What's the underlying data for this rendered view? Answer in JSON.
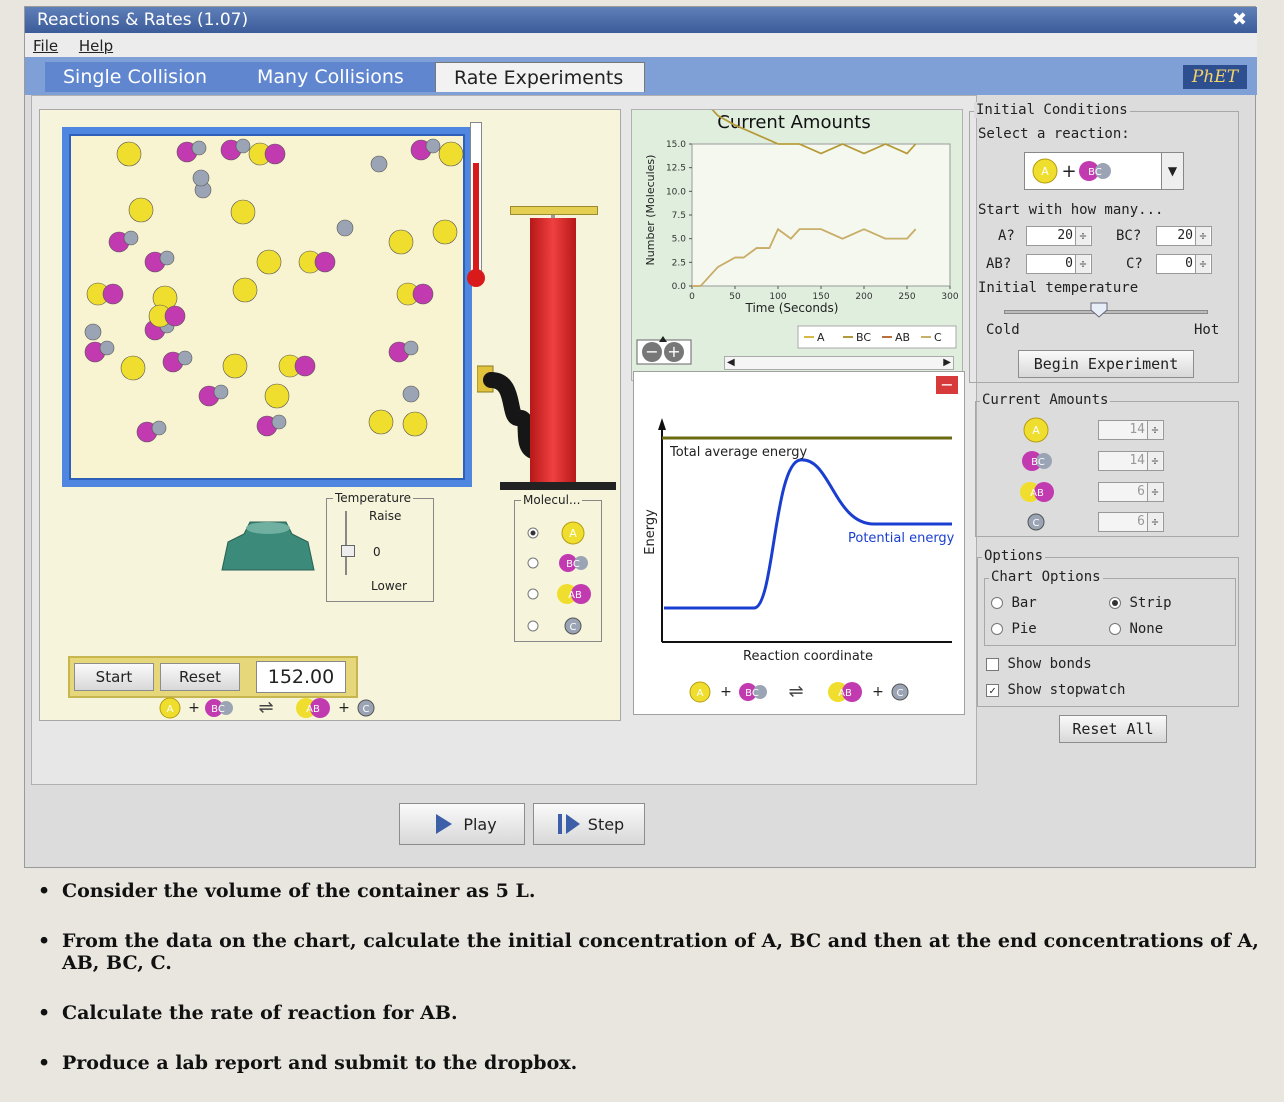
{
  "window": {
    "title": "Reactions & Rates (1.07)",
    "menu": [
      "File",
      "Help"
    ],
    "logo_text": "PhET"
  },
  "tabs": [
    {
      "label": "Single Collision",
      "active": false
    },
    {
      "label": "Many Collisions",
      "active": false
    },
    {
      "label": "Rate Experiments",
      "active": true
    }
  ],
  "simulation": {
    "temperature": {
      "title": "Temperature",
      "raise": "Raise",
      "zero": "0",
      "lower": "Lower"
    },
    "molecules": {
      "title": "Molecul..."
    },
    "controls": {
      "start_label": "Start",
      "reset_label": "Reset",
      "stopwatch_value": "152.00"
    },
    "reaction_equation": [
      "A",
      "+",
      "BC",
      "⇌",
      "AB",
      "+",
      "C"
    ],
    "playback": {
      "play_label": "Play",
      "step_label": "Step"
    }
  },
  "chart_data": {
    "type": "line",
    "title": "Current Amounts",
    "xlabel": "Time (Seconds)",
    "ylabel": "Number (Molecules)",
    "x_ticks": [
      "0",
      "50",
      "100",
      "150",
      "200",
      "250",
      "300"
    ],
    "y_ticks": [
      "0.0",
      "2.5",
      "5.0",
      "7.5",
      "10.0",
      "12.5",
      "15.0"
    ],
    "xlim": [
      0,
      300
    ],
    "ylim": [
      0,
      15
    ],
    "legend": [
      "A",
      "BC",
      "AB",
      "C"
    ],
    "series": [
      {
        "name": "A",
        "color": "#d9b84a",
        "points": [
          [
            0,
            20
          ],
          [
            10,
            20
          ],
          [
            30,
            18
          ],
          [
            50,
            17
          ],
          [
            75,
            16
          ],
          [
            100,
            15
          ],
          [
            125,
            15
          ],
          [
            150,
            14
          ],
          [
            175,
            15
          ],
          [
            200,
            14
          ],
          [
            225,
            15
          ],
          [
            250,
            14
          ],
          [
            260,
            15
          ]
        ]
      },
      {
        "name": "BC",
        "color": "#b49a3a",
        "points": [
          [
            0,
            20
          ],
          [
            10,
            20
          ],
          [
            30,
            18
          ],
          [
            50,
            17
          ],
          [
            75,
            16
          ],
          [
            100,
            15
          ],
          [
            125,
            15
          ],
          [
            150,
            14
          ],
          [
            175,
            15
          ],
          [
            200,
            14
          ],
          [
            225,
            15
          ],
          [
            250,
            14
          ],
          [
            260,
            15
          ]
        ]
      },
      {
        "name": "AB",
        "color": "#b8703a",
        "points": [
          [
            0,
            0
          ],
          [
            10,
            0
          ],
          [
            30,
            2
          ],
          [
            50,
            3
          ],
          [
            60,
            3
          ],
          [
            75,
            4
          ],
          [
            90,
            4
          ],
          [
            100,
            6
          ],
          [
            115,
            5
          ],
          [
            125,
            6
          ],
          [
            150,
            6
          ],
          [
            175,
            5
          ],
          [
            200,
            6
          ],
          [
            225,
            5
          ],
          [
            250,
            5
          ],
          [
            260,
            6
          ]
        ]
      },
      {
        "name": "C",
        "color": "#c9b068",
        "points": [
          [
            0,
            0
          ],
          [
            10,
            0
          ],
          [
            30,
            2
          ],
          [
            50,
            3
          ],
          [
            60,
            3
          ],
          [
            75,
            4
          ],
          [
            90,
            4
          ],
          [
            100,
            6
          ],
          [
            115,
            5
          ],
          [
            125,
            6
          ],
          [
            150,
            6
          ],
          [
            175,
            5
          ],
          [
            200,
            6
          ],
          [
            225,
            5
          ],
          [
            250,
            5
          ],
          [
            260,
            6
          ]
        ]
      }
    ]
  },
  "energy_diagram": {
    "total_label": "Total average energy",
    "potential_label": "Potential energy",
    "xlabel": "Reaction coordinate",
    "ylabel": "Energy",
    "colors": {
      "total": "#6a6a10",
      "potential": "#1a3fd0"
    }
  },
  "initial_conditions": {
    "title": "Initial Conditions",
    "select_label": "Select a reaction:",
    "reaction_selected": [
      "A",
      "+",
      "BC"
    ],
    "start_with": "Start with how many...",
    "fields": [
      {
        "label": "A?",
        "value": "20"
      },
      {
        "label": "BC?",
        "value": "20"
      },
      {
        "label": "AB?",
        "value": "0"
      },
      {
        "label": "C?",
        "value": "0"
      }
    ],
    "temp_label": "Initial temperature",
    "cold": "Cold",
    "hot": "Hot",
    "begin_label": "Begin Experiment"
  },
  "current_amounts": {
    "title": "Current Amounts",
    "rows": [
      {
        "species": "A",
        "value": "14"
      },
      {
        "species": "BC",
        "value": "14"
      },
      {
        "species": "AB",
        "value": "6"
      },
      {
        "species": "C",
        "value": "6"
      }
    ]
  },
  "options": {
    "title": "Options",
    "chart_options_title": "Chart Options",
    "bar": "Bar",
    "strip": "Strip",
    "pie": "Pie",
    "none": "None",
    "show_bonds": "Show bonds",
    "show_stopwatch": "Show stopwatch",
    "reset_all": "Reset All"
  },
  "instructions": [
    "Consider the volume of the container as 5 L.",
    "From the data on the chart, calculate the initial concentration of A, BC and then at the end concentrations of A, AB, BC, C.",
    "Calculate the rate of reaction for AB.",
    "Produce a lab report and submit to the dropbox."
  ],
  "colors": {
    "atom_a": "#f0de2e",
    "atom_b": "#c23ab0",
    "atom_c": "#9aa4b4",
    "tab_bar": "#7ea0d6",
    "title_bar": "#3b5c99"
  }
}
